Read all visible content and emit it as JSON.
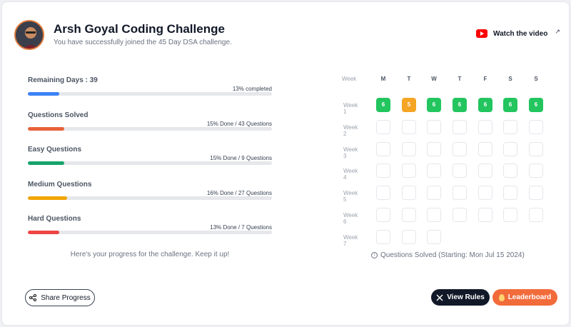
{
  "header": {
    "title": "Arsh Goyal Coding Challenge",
    "subtitle": "You have successfully joined the 45 Day DSA challenge.",
    "watch_video": "Watch the video"
  },
  "progress": [
    {
      "label": "Remaining Days : 39",
      "status": "13% completed",
      "percent": 13,
      "color": "#3b82f6"
    },
    {
      "label": "Questions Solved",
      "status": "15% Done / 43 Questions",
      "percent": 15,
      "color": "#e8623a"
    },
    {
      "label": "Easy Questions",
      "status": "15% Done / 9 Questions",
      "percent": 15,
      "color": "#16a36a"
    },
    {
      "label": "Medium Questions",
      "status": "16% Done / 27 Questions",
      "percent": 16,
      "color": "#f0a500"
    },
    {
      "label": "Hard Questions",
      "status": "13% Done / 7 Questions",
      "percent": 13,
      "color": "#ef4444"
    }
  ],
  "progress_note": "Here's your progress for the challenge. Keep it up!",
  "calendar": {
    "week_header": "Week",
    "days": [
      "M",
      "T",
      "W",
      "T",
      "F",
      "S",
      "S"
    ],
    "weeks": [
      {
        "label": "Week 1",
        "cells": [
          "6",
          "5",
          "6",
          "6",
          "6",
          "6",
          "6"
        ],
        "states": [
          "done",
          "partial",
          "done",
          "done",
          "done",
          "done",
          "done"
        ]
      },
      {
        "label": "Week 2",
        "cells": [
          "",
          "",
          "",
          "",
          "",
          "",
          ""
        ]
      },
      {
        "label": "Week 3",
        "cells": [
          "",
          "",
          "",
          "",
          "",
          "",
          ""
        ]
      },
      {
        "label": "Week 4",
        "cells": [
          "",
          "",
          "",
          "",
          "",
          "",
          ""
        ]
      },
      {
        "label": "Week 5",
        "cells": [
          "",
          "",
          "",
          "",
          "",
          "",
          ""
        ]
      },
      {
        "label": "Week 6",
        "cells": [
          "",
          "",
          "",
          "",
          "",
          "",
          ""
        ]
      },
      {
        "label": "Week 7",
        "cells": [
          "",
          "",
          ""
        ]
      }
    ],
    "note": "Questions Solved (Starting: Mon Jul 15 2024)"
  },
  "footer": {
    "share_label": "Share Progress",
    "rules_label": "View Rules",
    "leaderboard_label": "Leaderboard"
  }
}
